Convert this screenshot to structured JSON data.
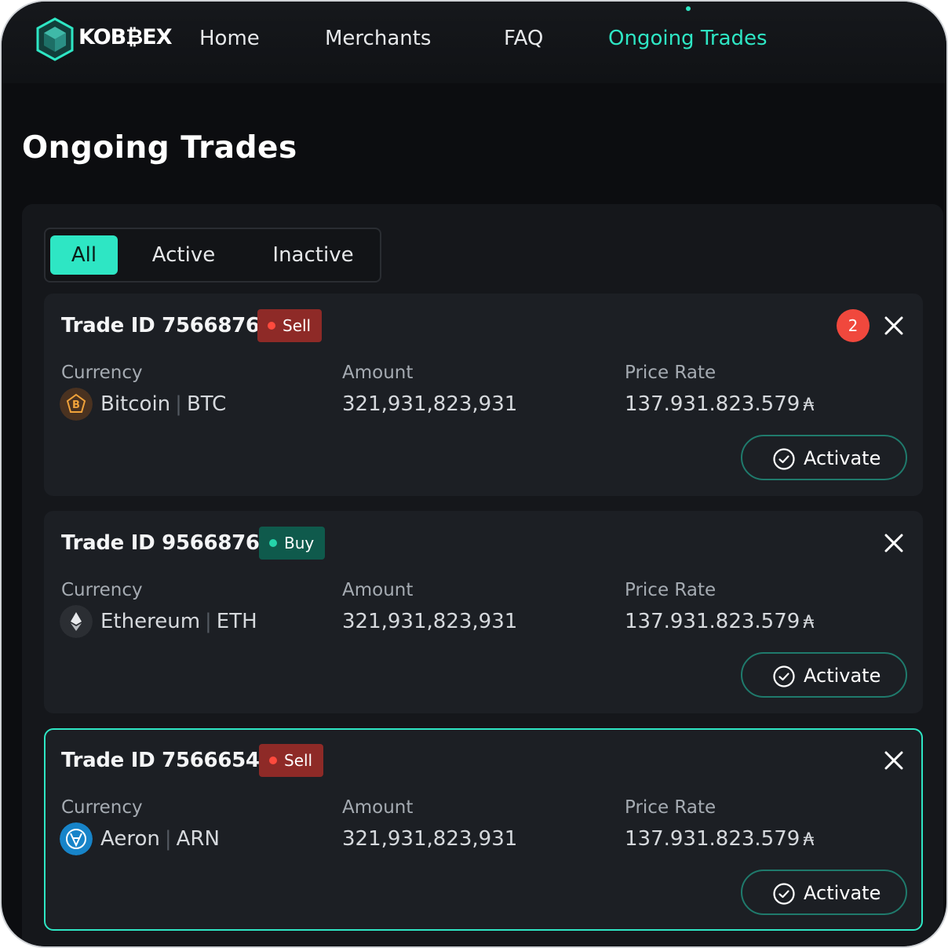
{
  "brand": {
    "name": "KOB₿EX"
  },
  "nav": {
    "items": [
      {
        "label": "Home"
      },
      {
        "label": "Merchants"
      },
      {
        "label": "FAQ"
      },
      {
        "label": "Ongoing Trades"
      }
    ],
    "active": "Ongoing Trades"
  },
  "page": {
    "title": "Ongoing Trades"
  },
  "filter_tabs": {
    "items": [
      {
        "label": "All"
      },
      {
        "label": "Active"
      },
      {
        "label": "Inactive"
      }
    ],
    "selected": "All"
  },
  "labels": {
    "currency": "Currency",
    "amount": "Amount",
    "price_rate": "Price Rate"
  },
  "trades": [
    {
      "trade_id": "Trade ID 7566876",
      "side": "Sell",
      "notifications": "2",
      "coin_name": "Bitcoin",
      "coin_symbol": "BTC",
      "coin_icon": "bitcoin-icon",
      "amount": "321,931,823,931",
      "price_rate": "137.931.823.579",
      "action": "Activate",
      "selected": false
    },
    {
      "trade_id": "Trade ID 9566876",
      "side": "Buy",
      "notifications": null,
      "coin_name": "Ethereum",
      "coin_symbol": "ETH",
      "coin_icon": "ethereum-icon",
      "amount": "321,931,823,931",
      "price_rate": "137.931.823.579",
      "action": "Activate",
      "selected": false
    },
    {
      "trade_id": "Trade ID 7566654",
      "side": "Sell",
      "notifications": null,
      "coin_name": "Aeron",
      "coin_symbol": "ARN",
      "coin_icon": "aeron-icon",
      "amount": "321,931,823,931",
      "price_rate": "137.931.823.579",
      "action": "Activate",
      "selected": true
    }
  ],
  "colors": {
    "accent": "#2ee6c4",
    "sell": "#8e2a27",
    "buy": "#0f5a4c",
    "notification": "#f0483d",
    "background": "#0c0d10"
  }
}
